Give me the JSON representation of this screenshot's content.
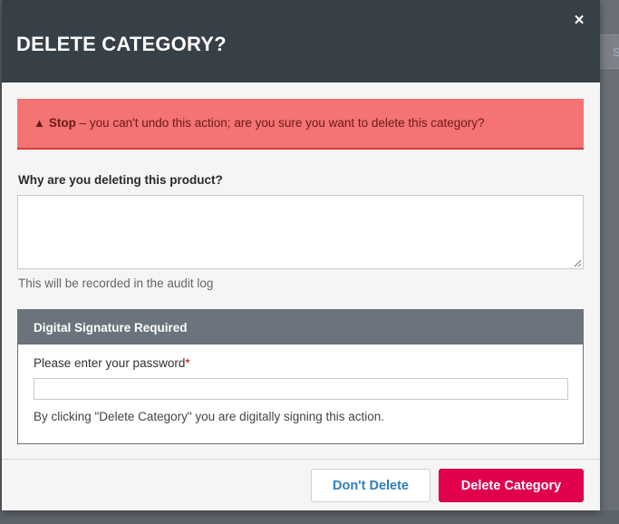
{
  "background": {
    "partial_char": "S"
  },
  "modal": {
    "title": "DELETE CATEGORY?",
    "close_glyph": "×"
  },
  "alert": {
    "icon": "warning-triangle-icon",
    "icon_glyph": "▲",
    "strong": "Stop",
    "message": " – you can't undo this action; are you sure you want to delete this category?"
  },
  "reason": {
    "label": "Why are you deleting this product?",
    "value": "",
    "placeholder": "",
    "help": "This will be recorded in the audit log"
  },
  "signature": {
    "header": "Digital Signature Required",
    "password_label": "Please enter your password",
    "required_marker": "*",
    "password_value": "",
    "note": "By clicking \"Delete Category\" you are digitally signing this action."
  },
  "footer": {
    "cancel_label": "Don't Delete",
    "confirm_label": "Delete Category"
  },
  "colors": {
    "header_bg": "#373f47",
    "alert_bg": "#f47373",
    "sig_header_bg": "#6b747c",
    "confirm_bg": "#e0004d",
    "cancel_text": "#2f7fc1"
  }
}
